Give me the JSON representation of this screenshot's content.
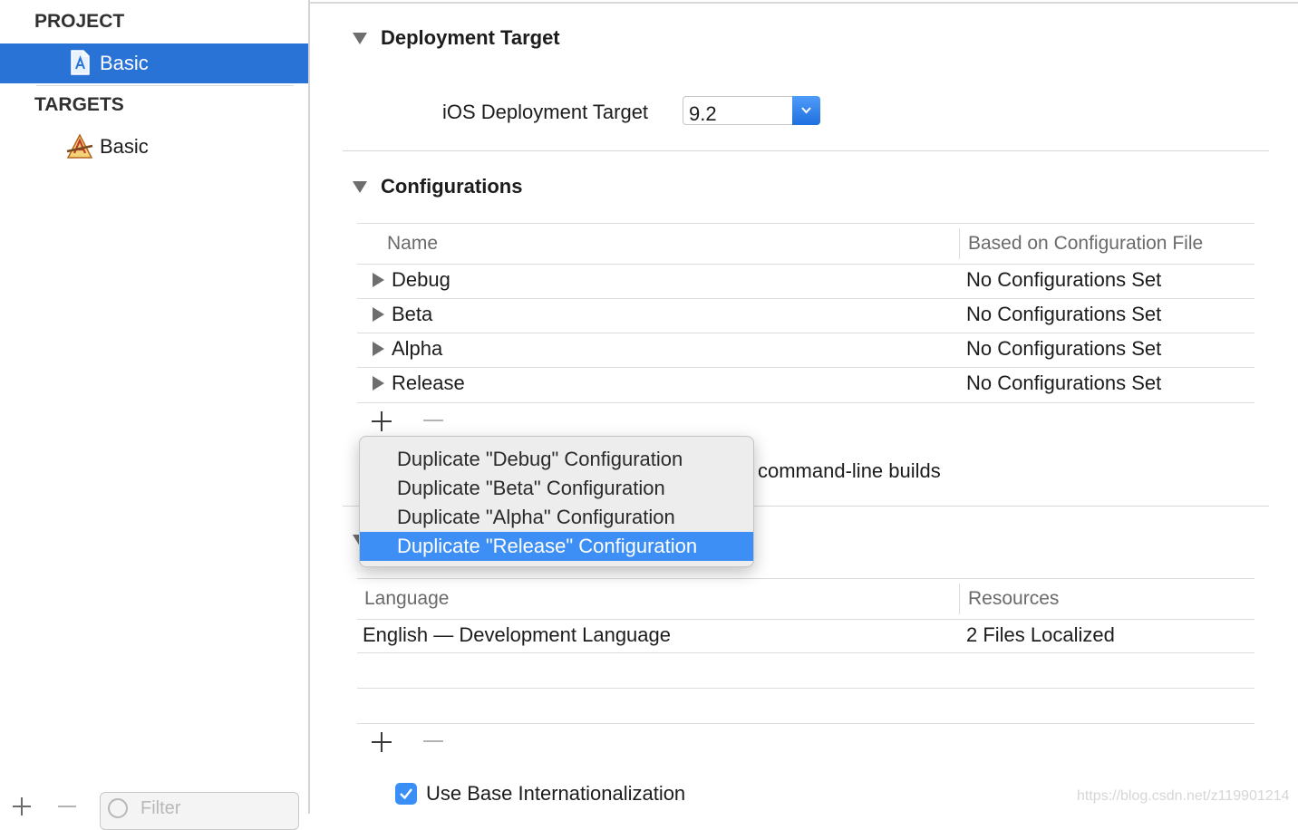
{
  "sidebar": {
    "project_header": "PROJECT",
    "project_item": {
      "label": "Basic",
      "icon": "project-file-icon",
      "selected": true
    },
    "targets_header": "TARGETS",
    "target_item": {
      "label": "Basic",
      "icon": "app-target-icon"
    },
    "filter_placeholder": "Filter"
  },
  "deployment": {
    "title": "Deployment Target",
    "ios_label": "iOS Deployment Target",
    "ios_value": "9.2"
  },
  "configurations": {
    "title": "Configurations",
    "columns": [
      "Name",
      "Based on Configuration File"
    ],
    "rows": [
      {
        "name": "Debug",
        "file": "No Configurations Set"
      },
      {
        "name": "Beta",
        "file": "No Configurations Set"
      },
      {
        "name": "Alpha",
        "file": "No Configurations Set"
      },
      {
        "name": "Release",
        "file": "No Configurations Set"
      }
    ],
    "partial_text": "command-line builds"
  },
  "menu": {
    "items": [
      "Duplicate \"Debug\" Configuration",
      "Duplicate \"Beta\" Configuration",
      "Duplicate \"Alpha\" Configuration",
      "Duplicate \"Release\" Configuration"
    ],
    "highlighted_index": 3
  },
  "localizations": {
    "columns": [
      "Language",
      "Resources"
    ],
    "rows": [
      {
        "language": "English — Development Language",
        "resources": "2 Files Localized"
      }
    ],
    "base_internationalization_label": "Use Base Internationalization",
    "base_internationalization_checked": true
  },
  "watermark": "https://blog.csdn.net/z119901214",
  "colors": {
    "selection_blue": "#2a73d6",
    "menu_highlight": "#3d8ff5",
    "checkbox_blue": "#3a8ff7"
  }
}
